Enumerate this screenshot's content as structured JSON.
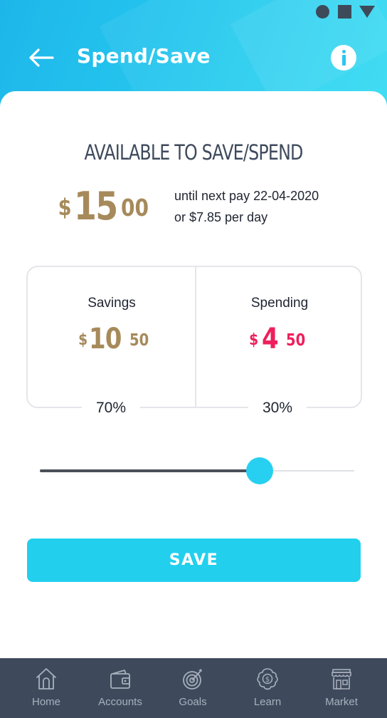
{
  "header": {
    "title": "Spend/Save",
    "back_icon": "arrow-left-icon",
    "info_icon": "info-icon"
  },
  "status_bar": {
    "icons": [
      "circle-icon",
      "square-icon",
      "triangle-icon"
    ]
  },
  "available": {
    "heading": "AVAILABLE TO SAVE/SPEND",
    "currency": "$",
    "whole": "15",
    "cents": "00",
    "until_line": "until next pay 22-04-2020",
    "per_day_line": "or $7.85 per day"
  },
  "split": {
    "savings": {
      "label": "Savings",
      "currency": "$",
      "whole": "10",
      "cents": "50",
      "percent_text": "70%"
    },
    "spending": {
      "label": "Spending",
      "currency": "$",
      "whole": "4",
      "cents": "50",
      "percent_text": "30%"
    }
  },
  "slider": {
    "value": 0.7
  },
  "save_button": {
    "label": "SAVE"
  },
  "bottom_nav": {
    "items": [
      {
        "label": "Home",
        "icon": "home-icon"
      },
      {
        "label": "Accounts",
        "icon": "wallet-icon"
      },
      {
        "label": "Goals",
        "icon": "target-icon"
      },
      {
        "label": "Learn",
        "icon": "brain-dollar-icon"
      },
      {
        "label": "Market",
        "icon": "store-icon"
      }
    ]
  },
  "colors": {
    "accent": "#22d0ee",
    "header_gradient_start": "#1eb6ea",
    "gold": "#a68a5b",
    "pink": "#ee1f5c",
    "nav_bg": "#3e4a5c",
    "text_dark": "#3e4a5c"
  }
}
